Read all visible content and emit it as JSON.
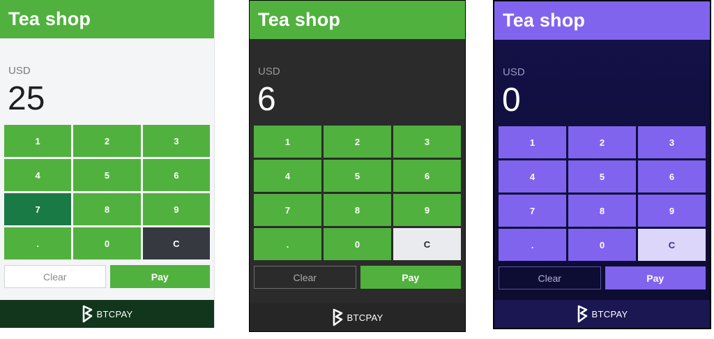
{
  "panels": [
    {
      "title": "Tea shop",
      "currency": "USD",
      "amount": "25",
      "keys": [
        "1",
        "2",
        "3",
        "4",
        "5",
        "6",
        "7",
        "8",
        "9",
        ".",
        "0",
        "C"
      ],
      "clear_label": "Clear",
      "pay_label": "Pay",
      "footer_brand": "BTCPAY",
      "colors": {
        "accent": "#51b13e",
        "background": "#f4f5f7",
        "footer": "#11361c"
      }
    },
    {
      "title": "Tea shop",
      "currency": "USD",
      "amount": "6",
      "keys": [
        "1",
        "2",
        "3",
        "4",
        "5",
        "6",
        "7",
        "8",
        "9",
        ".",
        "0",
        "C"
      ],
      "clear_label": "Clear",
      "pay_label": "Pay",
      "footer_brand": "BTCPAY",
      "colors": {
        "accent": "#51b13e",
        "background": "#2b2b2b",
        "footer": "#262626"
      }
    },
    {
      "title": "Tea shop",
      "currency": "USD",
      "amount": "0",
      "keys": [
        "1",
        "2",
        "3",
        "4",
        "5",
        "6",
        "7",
        "8",
        "9",
        ".",
        "0",
        "C"
      ],
      "clear_label": "Clear",
      "pay_label": "Pay",
      "footer_brand": "BTCPAY",
      "colors": {
        "accent": "#8064ee",
        "background": "#14124a",
        "footer": "#1a1752"
      }
    }
  ]
}
